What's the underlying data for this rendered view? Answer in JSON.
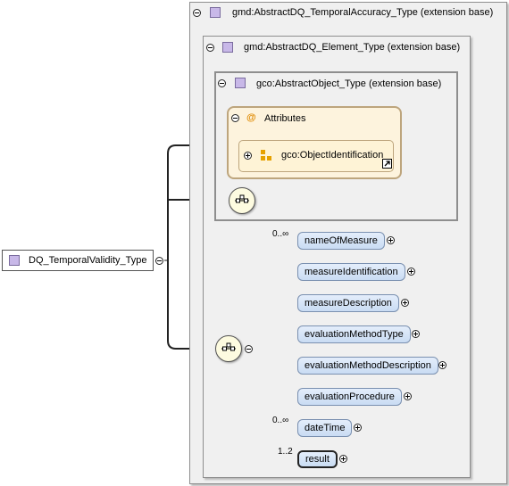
{
  "root": {
    "label": "DQ_TemporalValidity_Type"
  },
  "base1": {
    "label": "gmd:AbstractDQ_TemporalAccuracy_Type (extension base)"
  },
  "base2": {
    "label": "gmd:AbstractDQ_Element_Type (extension base)"
  },
  "base3": {
    "label": "gco:AbstractObject_Type (extension base)"
  },
  "attributes": {
    "label": "Attributes",
    "at_symbol": "@",
    "group": "gco:ObjectIdentification"
  },
  "elements": [
    {
      "label": "nameOfMeasure",
      "mult": "0..∞"
    },
    {
      "label": "measureIdentification",
      "mult": ""
    },
    {
      "label": "measureDescription",
      "mult": ""
    },
    {
      "label": "evaluationMethodType",
      "mult": ""
    },
    {
      "label": "evaluationMethodDescription",
      "mult": ""
    },
    {
      "label": "evaluationProcedure",
      "mult": ""
    },
    {
      "label": "dateTime",
      "mult": "0..∞"
    },
    {
      "label": "result",
      "mult": "1..2"
    }
  ],
  "colors": {
    "element_fill": "#c9dcf3",
    "attribute_fill": "#fdf3dd",
    "container_fill": "#f0f0f0"
  }
}
